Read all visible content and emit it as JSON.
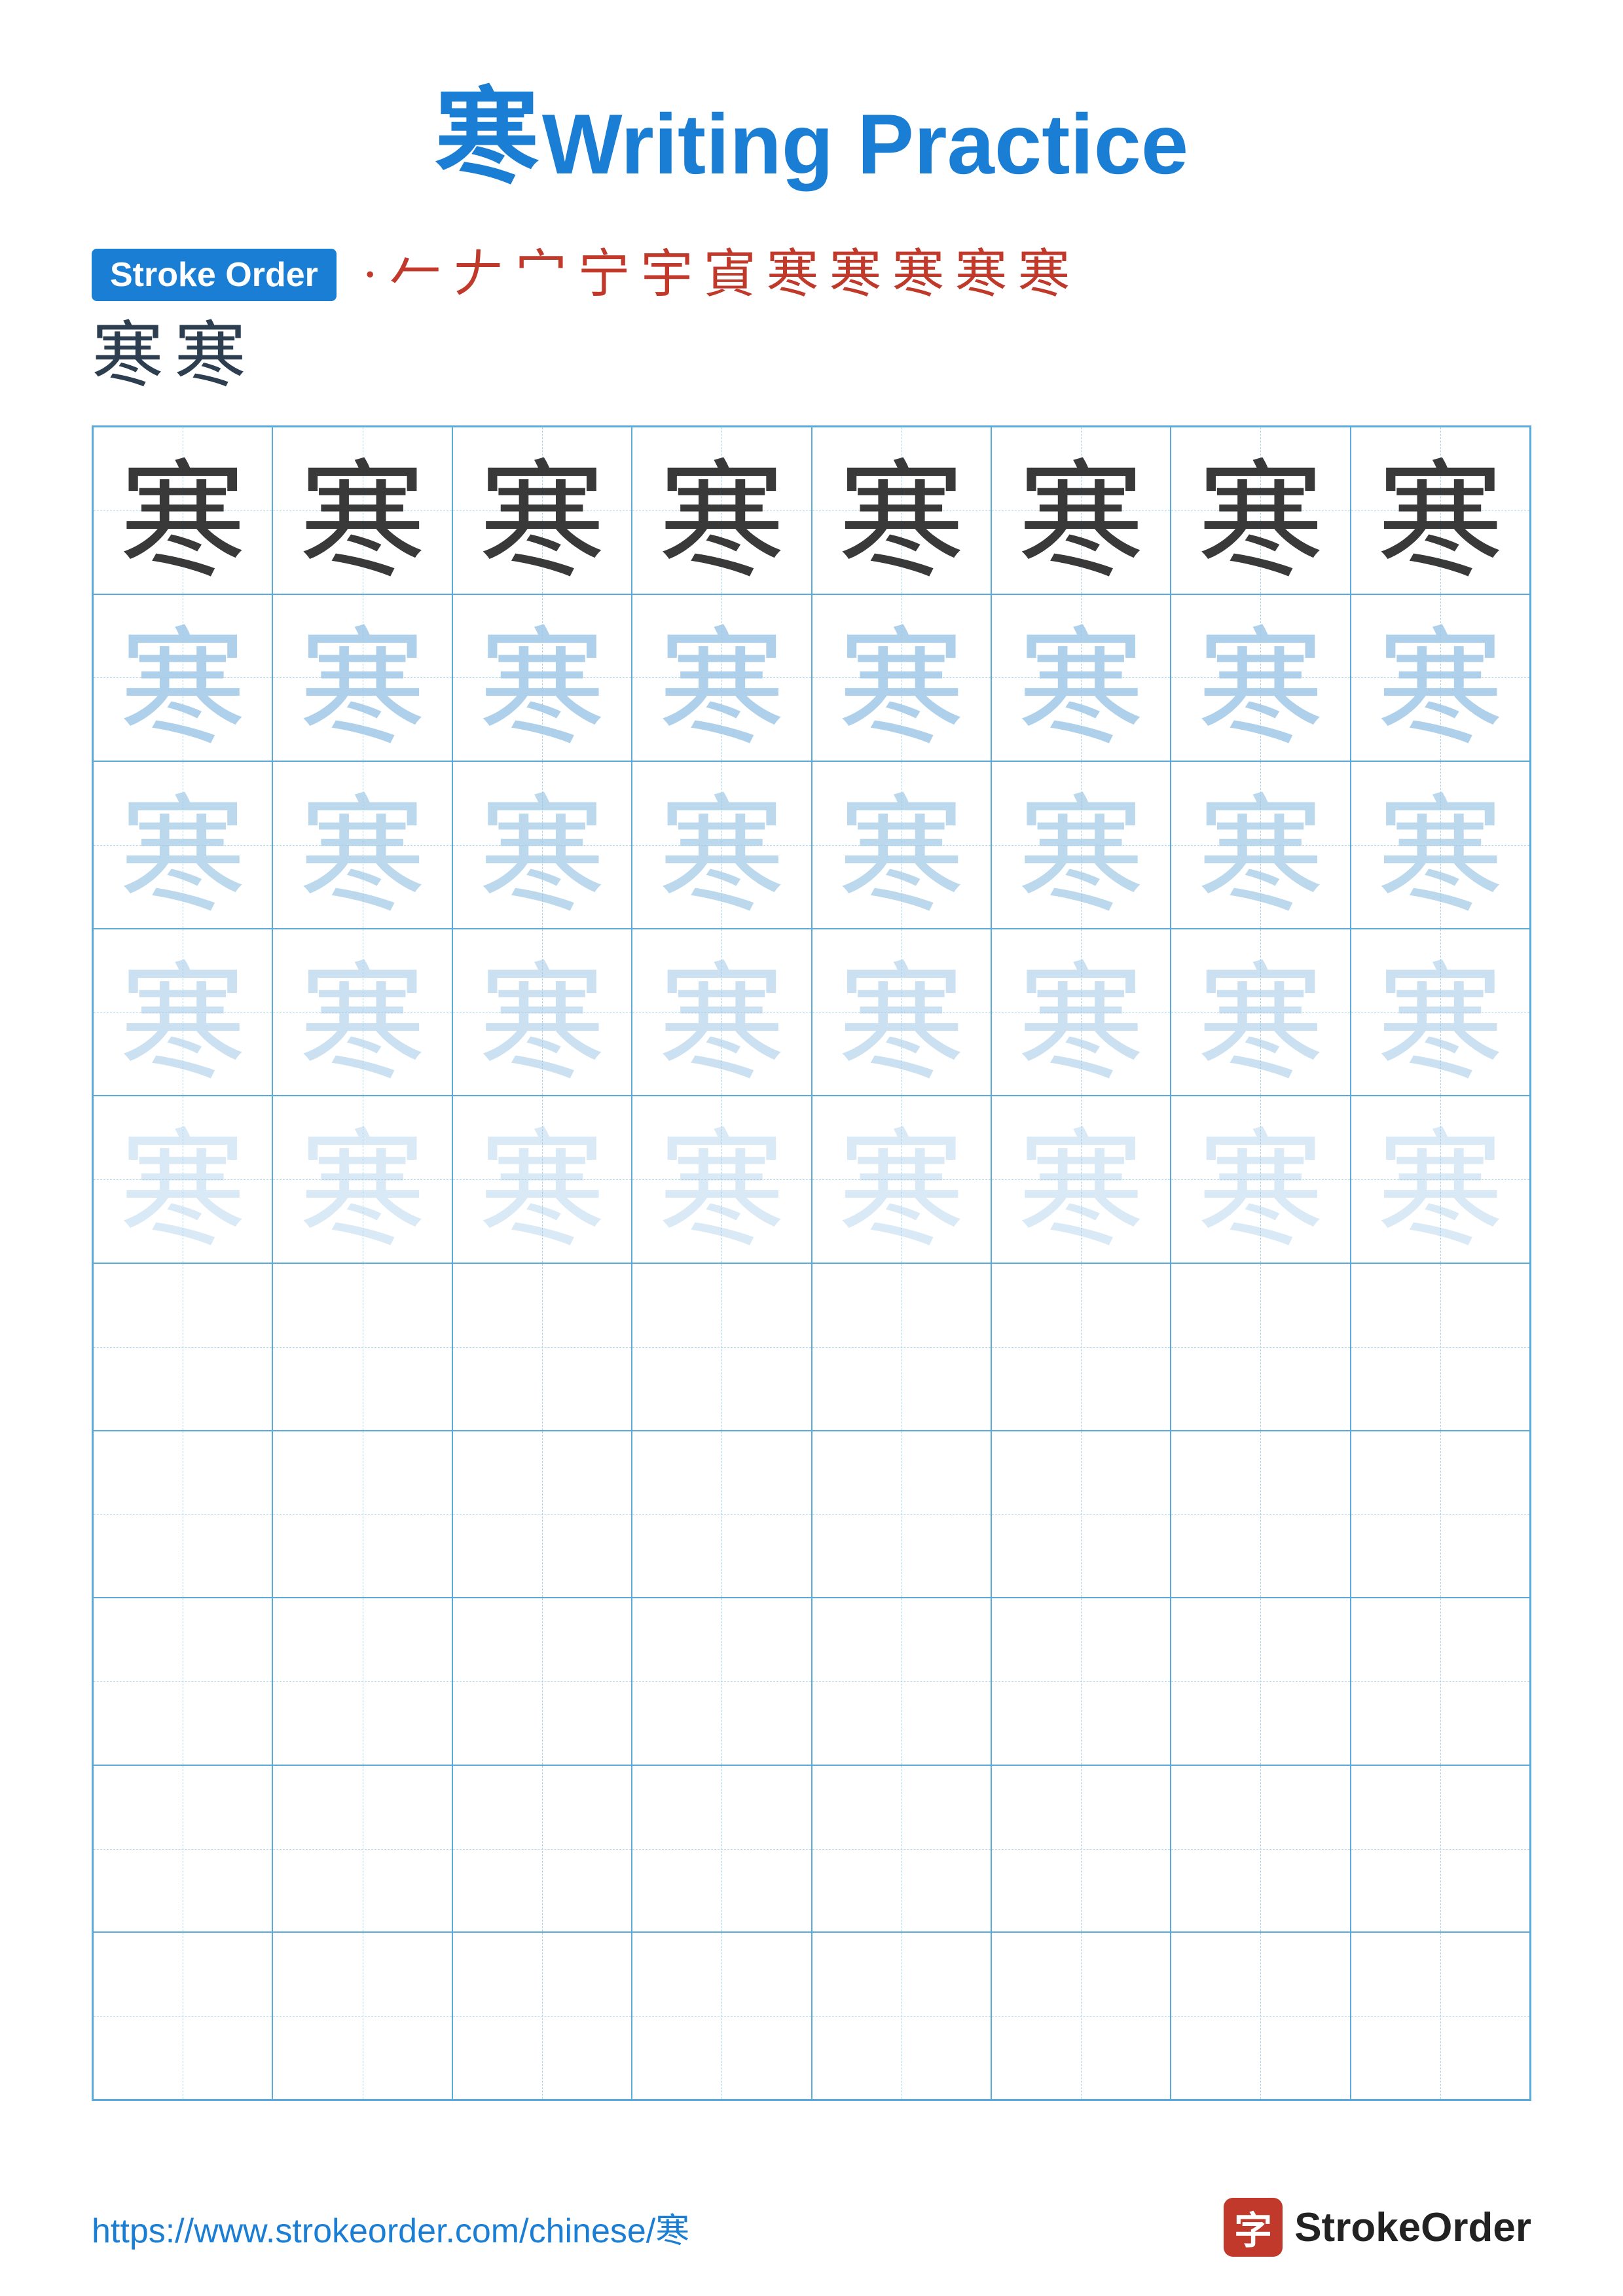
{
  "title": {
    "char": "寒",
    "text": "Writing Practice"
  },
  "stroke_order": {
    "badge_label": "Stroke Order",
    "strokes": [
      "·",
      "⺀",
      "𠂉",
      "宀",
      "宁",
      "宇",
      "宑",
      "寊",
      "寒",
      "寒",
      "寒",
      "寒",
      "寒",
      "寒"
    ]
  },
  "grid": {
    "char": "寒",
    "rows": 10,
    "cols": 8
  },
  "footer": {
    "url": "https://www.strokeorder.com/chinese/寒",
    "logo_char": "字",
    "logo_text": "StrokeOrder"
  }
}
